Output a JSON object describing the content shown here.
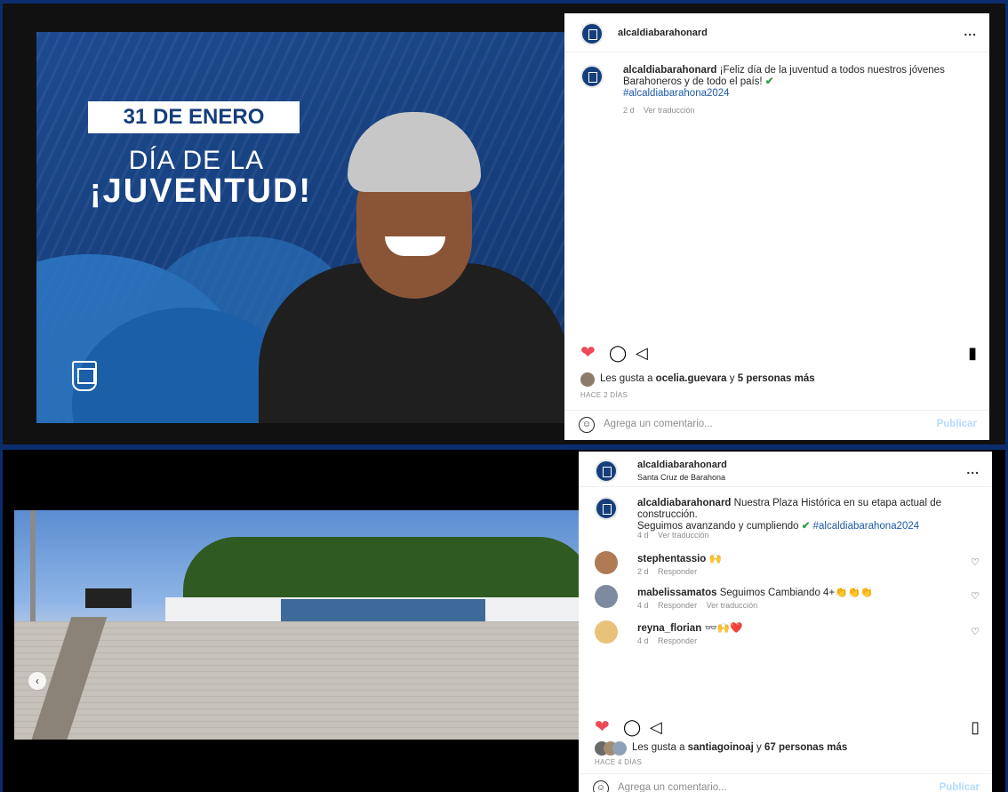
{
  "post1": {
    "image": {
      "date_label": "31 DE ENERO",
      "title_line1": "DÍA DE LA",
      "title_line2": "¡JUVENTUD!"
    },
    "header": {
      "username": "alcaldiabarahonard",
      "more": "..."
    },
    "caption": {
      "username": "alcaldiabarahonard",
      "text": "¡Feliz día de la juventud a todos nuestros jóvenes Barahoneros y de todo el país!",
      "hashtag": "#alcaldiabarahona2024",
      "time": "2 d",
      "translate": "Ver traducción"
    },
    "likes": {
      "prefix": "Les gusta a",
      "user": "ocelia.guevara",
      "joiner": "y",
      "others": "5 personas más"
    },
    "timestamp": "HACE 2 DÍAS",
    "comment_box": {
      "placeholder": "Agrega un comentario...",
      "publish": "Publicar"
    }
  },
  "post2": {
    "header": {
      "username": "alcaldiabarahonard",
      "location": "Santa Cruz de Barahona",
      "more": "..."
    },
    "caption": {
      "username": "alcaldiabarahonard",
      "text_line1": "Nuestra Plaza Histórica en su etapa actual de construcción.",
      "text_line2": "Seguimos avanzando y cumpliendo",
      "hashtag": "#alcaldiabarahona2024",
      "time": "4 d",
      "translate": "Ver traducción"
    },
    "comments": [
      {
        "user": "stephentassio",
        "text": "🙌",
        "time": "2 d",
        "reply": "Responder",
        "translate": ""
      },
      {
        "user": "mabelissamatos",
        "text": "Seguimos Cambiando 4+👏👏👏",
        "time": "4 d",
        "reply": "Responder",
        "translate": "Ver traducción"
      },
      {
        "user": "reyna_florian",
        "text": "👓🙌❤️",
        "time": "4 d",
        "reply": "Responder",
        "translate": ""
      }
    ],
    "likes": {
      "prefix": "Les gusta a",
      "user": "santiagoinoaj",
      "joiner": "y",
      "others": "67 personas más"
    },
    "timestamp": "HACE 4 DÍAS",
    "comment_box": {
      "placeholder": "Agrega un comentario...",
      "publish": "Publicar"
    }
  },
  "colors": {
    "brand_blue": "#163e7c",
    "like_red": "#ed4956",
    "link_blue": "#1d5aa8",
    "publish_disabled": "#b3dbff"
  },
  "icons": [
    "heart-icon",
    "comment-icon",
    "share-icon",
    "bookmark-icon",
    "emoji-icon",
    "more-icon",
    "chevron-left-icon"
  ]
}
